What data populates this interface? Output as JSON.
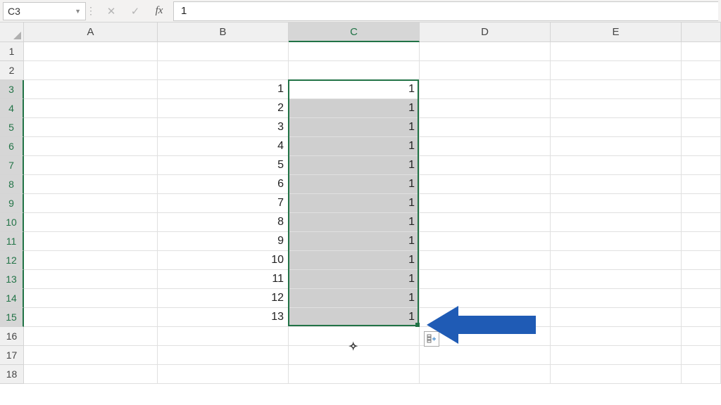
{
  "formula_bar": {
    "cell_ref": "C3",
    "value": "1",
    "fx_label": "fx",
    "cancel": "✕",
    "confirm": "✓"
  },
  "columns": [
    "A",
    "B",
    "C",
    "D",
    "E"
  ],
  "selected_col": "C",
  "rows": [
    1,
    2,
    3,
    4,
    5,
    6,
    7,
    8,
    9,
    10,
    11,
    12,
    13,
    14,
    15,
    16,
    17,
    18
  ],
  "selected_rows_start": 3,
  "selected_rows_end": 15,
  "data": {
    "B": {
      "3": "1",
      "4": "2",
      "5": "3",
      "6": "4",
      "7": "5",
      "8": "6",
      "9": "7",
      "10": "8",
      "11": "9",
      "12": "10",
      "13": "11",
      "14": "12",
      "15": "13"
    },
    "C": {
      "3": "1",
      "4": "1",
      "5": "1",
      "6": "1",
      "7": "1",
      "8": "1",
      "9": "1",
      "10": "1",
      "11": "1",
      "12": "1",
      "13": "1",
      "14": "1",
      "15": "1"
    }
  }
}
